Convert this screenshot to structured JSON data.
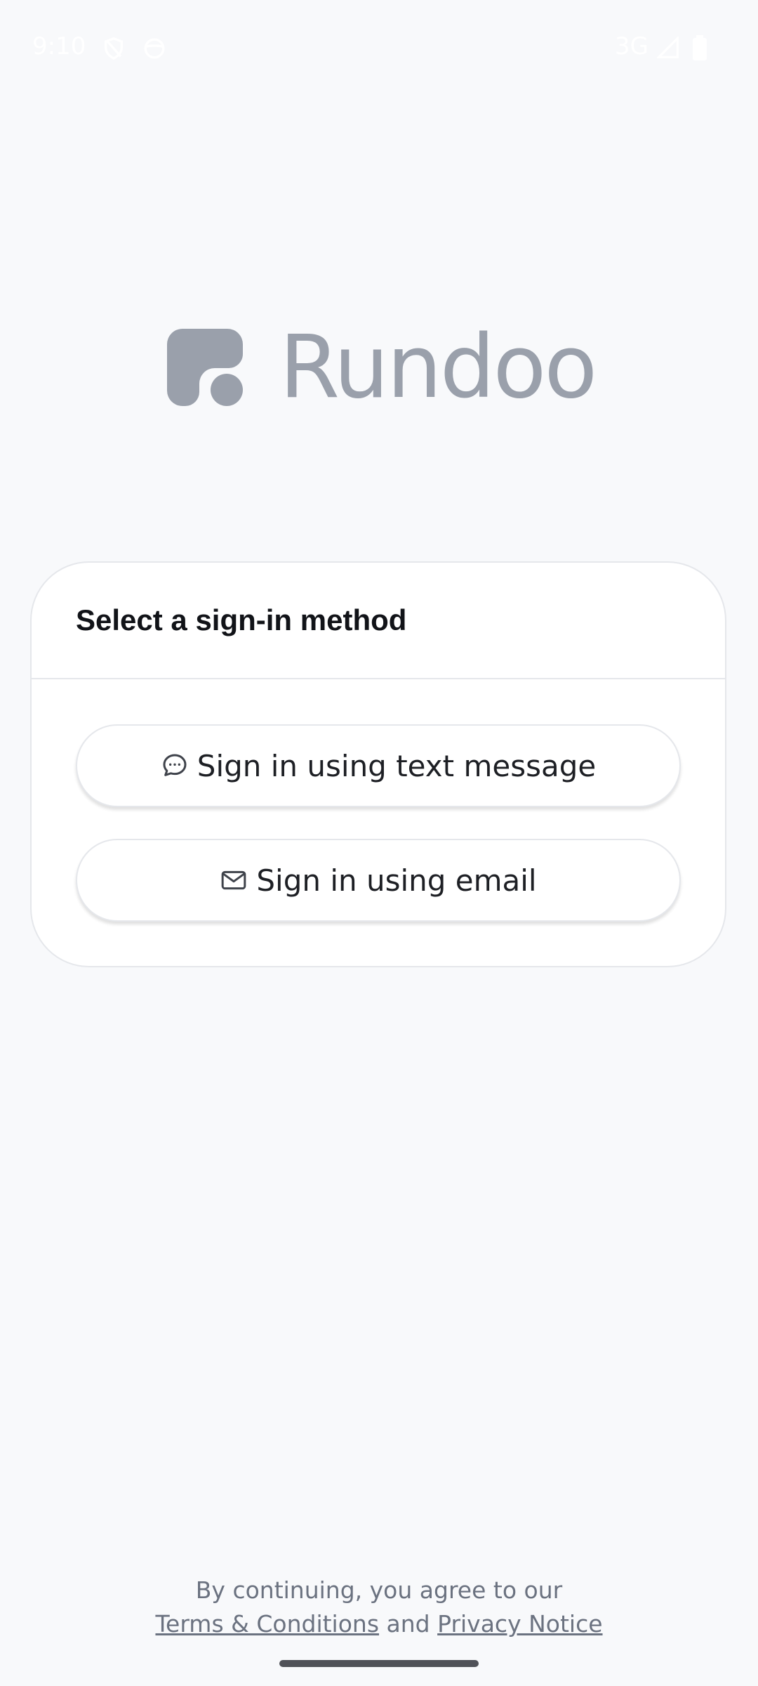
{
  "status_bar": {
    "time": "9:10",
    "network": "3G",
    "icons": [
      "shield-icon",
      "face-icon",
      "signal-icon",
      "battery-icon"
    ]
  },
  "brand": {
    "name": "Rundoo",
    "color": "#9aa0ab"
  },
  "sign_in": {
    "title": "Select a sign-in method",
    "methods": [
      {
        "label": "Sign in using text message",
        "icon": "chat-bubble-icon"
      },
      {
        "label": "Sign in using email",
        "icon": "mail-icon"
      }
    ]
  },
  "legal": {
    "line1": "By continuing, you agree to our",
    "terms_link": "Terms & Conditions",
    "conjunction": "and",
    "privacy_link": "Privacy Notice"
  }
}
